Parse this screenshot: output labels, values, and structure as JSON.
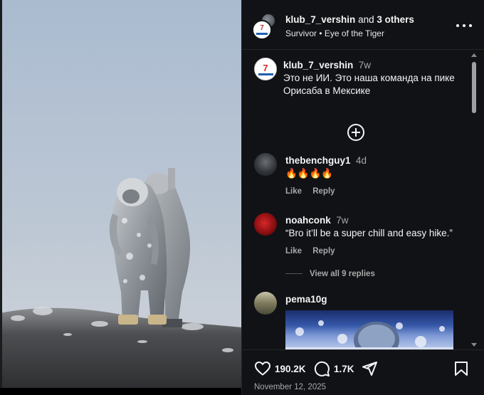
{
  "header": {
    "username": "klub_7_vershin",
    "and_text": "and",
    "others": "3 others",
    "music_artist": "Survivor",
    "music_separator": "•",
    "music_title": "Eye of the Tiger"
  },
  "caption": {
    "username": "klub_7_vershin",
    "time": "7w",
    "text": "Это не ИИ. Это наша команда на пике Орисаба в Мексике"
  },
  "comments": [
    {
      "username": "thebenchguy1",
      "time": "4d",
      "text": "🔥🔥🔥🔥",
      "like_label": "Like",
      "reply_label": "Reply"
    },
    {
      "username": "noahconk",
      "time": "7w",
      "text": "“Bro it’ll be a super chill and easy hike.”",
      "like_label": "Like",
      "reply_label": "Reply",
      "view_replies": "View all 9 replies"
    },
    {
      "username": "pema10g",
      "time": "",
      "text": ""
    }
  ],
  "footer": {
    "likes": "190.2K",
    "comments": "1.7K",
    "date": "November 12, 2025"
  },
  "icons": {
    "more": "more-icon",
    "add": "add-circle-icon",
    "like": "heart-icon",
    "comment": "comment-icon",
    "share": "send-icon",
    "save": "bookmark-icon"
  },
  "colors": {
    "panel_bg": "#101216",
    "text": "#f5f5f5",
    "muted": "#a8a8a8",
    "divider": "#262626"
  }
}
